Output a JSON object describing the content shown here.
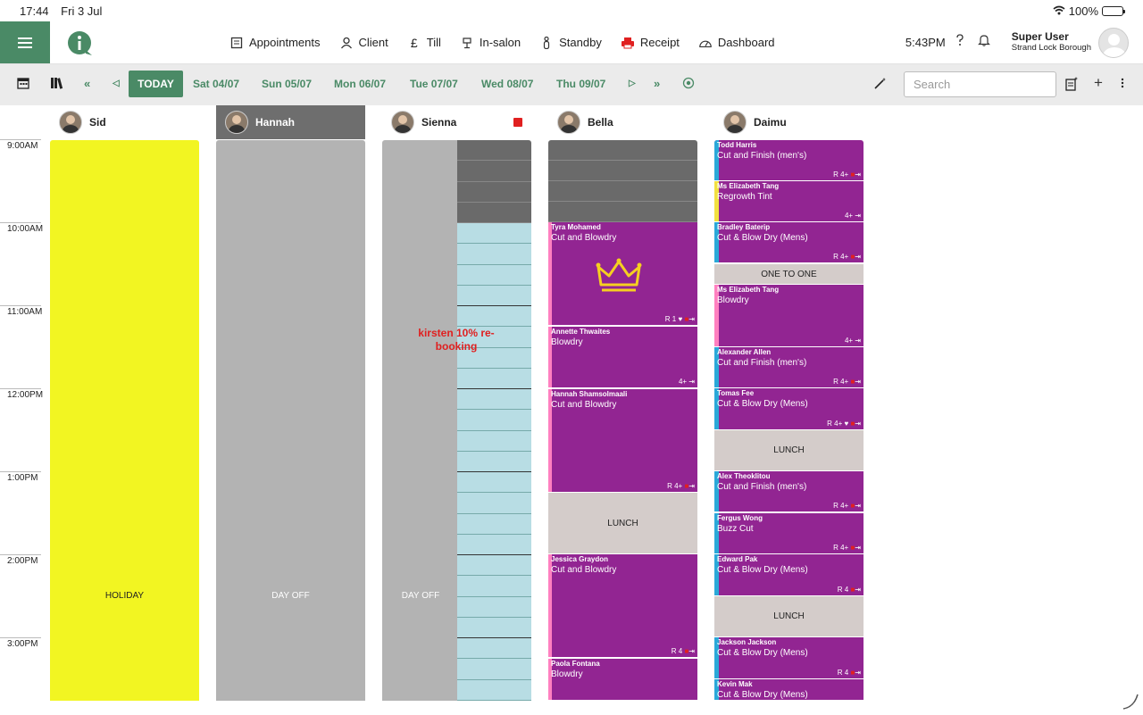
{
  "status_bar": {
    "time": "17:44",
    "date": "Fri 3 Jul",
    "battery": "100%"
  },
  "nav": {
    "items": [
      {
        "label": "Appointments",
        "icon": "appointments-book-icon"
      },
      {
        "label": "Client",
        "icon": "client-person-icon"
      },
      {
        "label": "Till",
        "icon": "pound-sign-icon"
      },
      {
        "label": "In-salon",
        "icon": "in-salon-chair-icon"
      },
      {
        "label": "Standby",
        "icon": "standby-person-icon"
      },
      {
        "label": "Receipt",
        "icon": "printer-icon"
      },
      {
        "label": "Dashboard",
        "icon": "gauge-icon"
      }
    ],
    "clock": "5:43PM",
    "user_name": "Super User",
    "user_site": "Strand Lock Borough"
  },
  "toolbar": {
    "today": "TODAY",
    "dates": [
      "Sat 04/07",
      "Sun 05/07",
      "Mon 06/07",
      "Tue 07/07",
      "Wed 08/07",
      "Thu 09/07"
    ],
    "search_placeholder": "Search"
  },
  "staff": [
    "Sid",
    "Hannah",
    "Sienna",
    "Bella",
    "Daimu"
  ],
  "times": [
    "9:00AM",
    "10:00AM",
    "11:00AM",
    "12:00PM",
    "1:00PM",
    "2:00PM",
    "3:00PM"
  ],
  "labels": {
    "holiday": "HOLIDAY",
    "day_off": "DAY OFF",
    "lunch": "LUNCH",
    "one_to_one": "ONE TO ONE",
    "sienna_note": "kirsten 10% re-booking"
  },
  "colors": {
    "brand_green": "#4a8a66",
    "appointment_purple": "#922592",
    "holiday_yellow": "#f2f522",
    "day_off_grey": "#b3b3b3"
  },
  "bella_appts": [
    {
      "client": "Tyra Mohamed",
      "service": "Cut and Blowdry",
      "marks": "R 1 ♥"
    },
    {
      "client": "Annette Thwaites",
      "service": "Blowdry",
      "marks": "4+"
    },
    {
      "client": "Hannah Shamsolmaali",
      "service": "Cut and Blowdry",
      "marks": "R 4+"
    },
    {
      "client": "Jessica Graydon",
      "service": "Cut and Blowdry",
      "marks": "R 4"
    },
    {
      "client": "Paola Fontana",
      "service": "Blowdry",
      "marks": ""
    }
  ],
  "daimu_appts": [
    {
      "client": "Todd Harris",
      "service": "Cut and Finish (men's)",
      "marks": "R 4+"
    },
    {
      "client": "Ms Elizabeth Tang",
      "service": "Regrowth Tint",
      "marks": "4+"
    },
    {
      "client": "Bradley Baterip",
      "service": "Cut & Blow Dry (Mens)",
      "marks": "R 4+"
    },
    {
      "client": "Ms Elizabeth Tang",
      "service": "Blowdry",
      "marks": "4+"
    },
    {
      "client": "Alexander Allen",
      "service": "Cut and Finish (men's)",
      "marks": "R 4+"
    },
    {
      "client": "Tomas Fee",
      "service": "Cut & Blow Dry (Mens)",
      "marks": "R 4+ ♥"
    },
    {
      "client": "Alex Theoklitou",
      "service": "Cut and Finish (men's)",
      "marks": "R 4+"
    },
    {
      "client": "Fergus Wong",
      "service": "Buzz Cut",
      "marks": "R 4+"
    },
    {
      "client": "Edward Pak",
      "service": "Cut & Blow Dry (Mens)",
      "marks": "R 4"
    },
    {
      "client": "Jackson Jackson",
      "service": "Cut & Blow Dry (Mens)",
      "marks": "R 4"
    },
    {
      "client": "Kevin Mak",
      "service": "Cut & Blow Dry (Mens)",
      "marks": ""
    }
  ]
}
